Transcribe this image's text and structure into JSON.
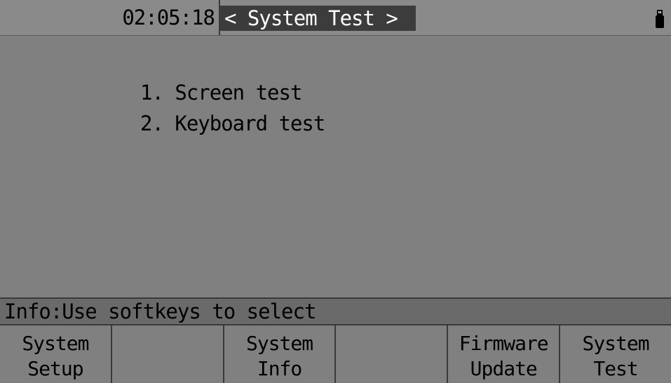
{
  "header": {
    "clock": "02:05:18",
    "title": "< System Test >"
  },
  "status": {
    "usb_icon": "usb-drive-icon"
  },
  "menu": {
    "items": [
      "1. Screen test",
      "2. Keyboard test"
    ]
  },
  "info": {
    "text": "Info:Use softkeys to select"
  },
  "softkeys": [
    {
      "line1": "System",
      "line2": "Setup"
    },
    {
      "line1": "",
      "line2": ""
    },
    {
      "line1": "System",
      "line2": "Info"
    },
    {
      "line1": "",
      "line2": ""
    },
    {
      "line1": "Firmware",
      "line2": "Update"
    },
    {
      "line1": "System",
      "line2": "Test"
    }
  ],
  "colors": {
    "background": "#808080",
    "title_bg": "#3c3c3c",
    "info_bg": "#6a6a6a"
  }
}
